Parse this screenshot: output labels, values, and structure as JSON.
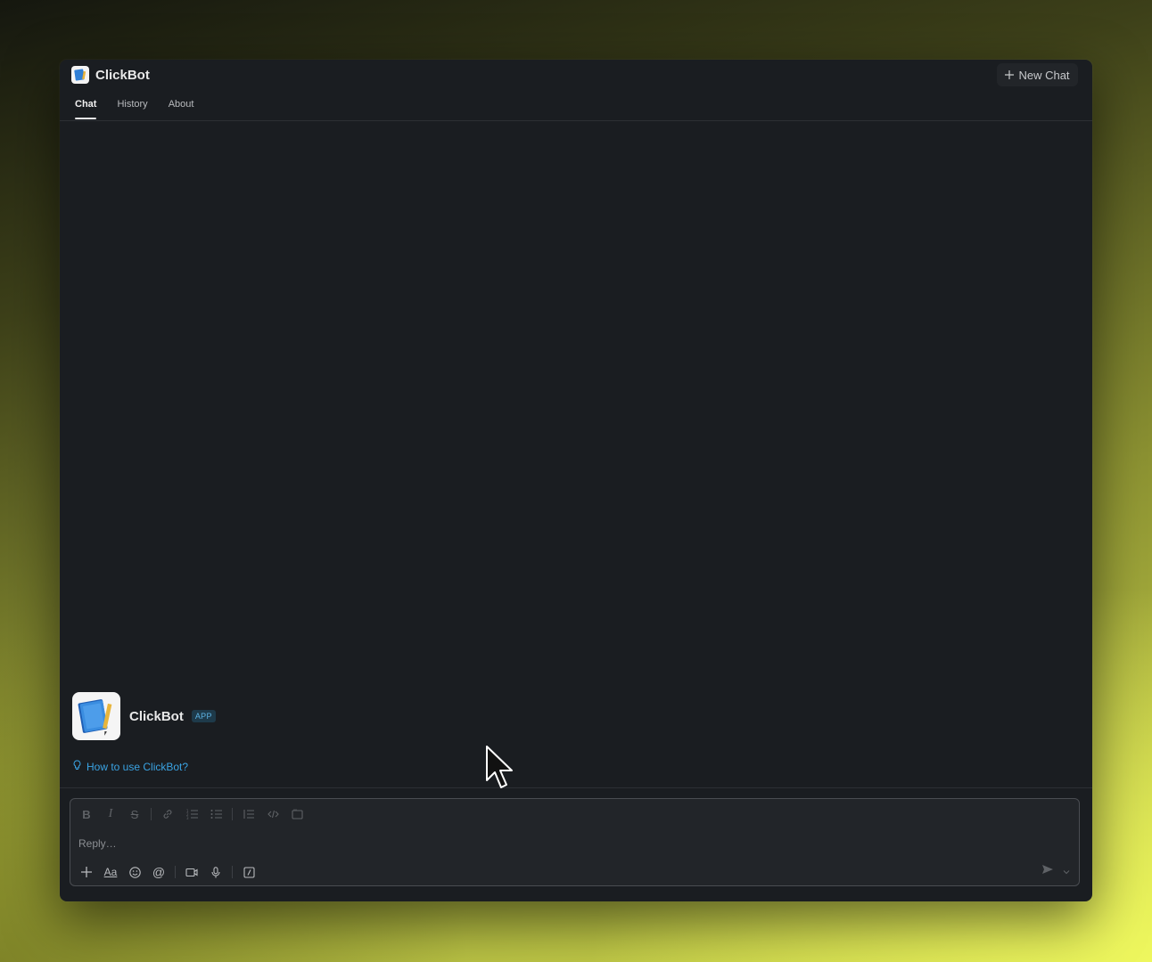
{
  "app": {
    "title": "ClickBot",
    "new_chat_label": "New Chat"
  },
  "tabs": [
    {
      "label": "Chat",
      "active": true
    },
    {
      "label": "History",
      "active": false
    },
    {
      "label": "About",
      "active": false
    }
  ],
  "bot": {
    "name": "ClickBot",
    "badge": "APP",
    "howto_link": "How to use ClickBot?"
  },
  "composer": {
    "placeholder": "Reply…",
    "format_icons": [
      "bold-icon",
      "italic-icon",
      "strikethrough-icon",
      "link-icon",
      "ordered-list-icon",
      "bulleted-list-icon",
      "blockquote-icon",
      "code-icon",
      "code-block-icon"
    ],
    "action_icons": [
      "plus-icon",
      "text-format-icon",
      "emoji-icon",
      "mention-icon",
      "video-icon",
      "microphone-icon",
      "slash-command-icon"
    ],
    "format_label": "Aa"
  },
  "colors": {
    "window_bg": "#1a1d21",
    "accent_link": "#3aa3e3",
    "badge_text": "#5db3e4"
  }
}
